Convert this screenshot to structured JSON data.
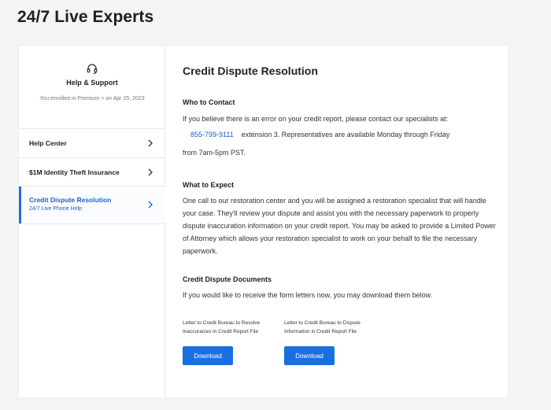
{
  "page": {
    "title": "24/7 Live Experts"
  },
  "sidebar": {
    "support_title": "Help & Support",
    "support_subtitle": "You enrolled in Premium + on Apr 25, 2023",
    "items": [
      {
        "label": "Help Center"
      },
      {
        "label": "$1M Identity Theft Insurance"
      },
      {
        "label": "Credit Dispute Resolution",
        "sub": "24/7 Live Phone Help",
        "active": true
      }
    ]
  },
  "content": {
    "title": "Credit Dispute Resolution",
    "who": {
      "heading": "Who to Contact",
      "line1": "If you believe there is an error on your credit report, please contact our specialists at:",
      "phone": "855-799-9111",
      "line2": "extension 3. Representatives are available Monday through Friday",
      "line3": "from 7am-5pm PST."
    },
    "expect": {
      "heading": "What to Expect",
      "body": "One call to our restoration center and you will be assigned a restoration specialist that will handle your case. They'll review your dispute and assist you with the necessary paperwork to properly dispute inaccuration information on your credit report. You may be asked to provide a Limited Power of Attorney which allows your restoration specialist to work on your behalf to file the necessary paperwork."
    },
    "documents": {
      "heading": "Credit Dispute Documents",
      "intro": "If you would like to receive the form letters now, you may download them below.",
      "items": [
        {
          "label": "Letter to Credit Bureau to Resolve Inaccuracies in Credit Report File",
          "button": "Download"
        },
        {
          "label": "Letter to Credit Bureau to Dispute Information in Credit Report File",
          "button": "Download"
        }
      ]
    }
  },
  "colors": {
    "accent": "#1a6fe0",
    "link": "#1a5fd6"
  }
}
